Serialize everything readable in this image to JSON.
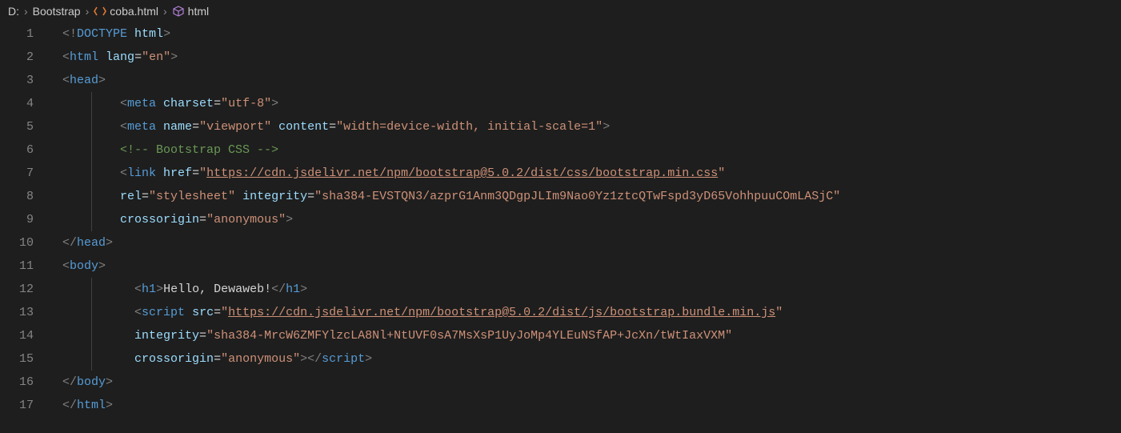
{
  "breadcrumb": {
    "drive": "D:",
    "folder": "Bootstrap",
    "file": "coba.html",
    "symbol": "html"
  },
  "gutter": [
    "1",
    "2",
    "3",
    "4",
    "5",
    "6",
    "7",
    "8",
    "9",
    "10",
    "11",
    "12",
    "13",
    "14",
    "15",
    "16",
    "17"
  ],
  "code": {
    "r1": {
      "a": "<!",
      "b": "DOCTYPE",
      "c": " html",
      "d": ">"
    },
    "r2": {
      "a": "<",
      "b": "html",
      "c": " lang",
      "d": "=",
      "e": "\"en\"",
      "f": ">"
    },
    "r3": {
      "a": "<",
      "b": "head",
      "c": ">"
    },
    "r4": {
      "a": "<",
      "b": "meta",
      "c": " charset",
      "d": "=",
      "e": "\"utf-8\"",
      "f": ">"
    },
    "r5": {
      "a": "<",
      "b": "meta",
      "c": " name",
      "d": "=",
      "e": "\"viewport\"",
      "f": " content",
      "g": "=",
      "h": "\"width=device-width, initial-scale=1\"",
      "i": ">"
    },
    "r6": {
      "a": "<!-- Bootstrap CSS -->"
    },
    "r7": {
      "a": "<",
      "b": "link",
      "c": " href",
      "d": "=",
      "e": "\"",
      "f": "https://cdn.jsdelivr.net/npm/bootstrap@5.0.2/dist/css/bootstrap.min.css",
      "g": "\""
    },
    "r8": {
      "a": "rel",
      "b": "=",
      "c": "\"stylesheet\"",
      "d": " integrity",
      "e": "=",
      "f": "\"sha384-EVSTQN3/azprG1Anm3QDgpJLIm9Nao0Yz1ztcQTwFspd3yD65VohhpuuCOmLASjC\""
    },
    "r9": {
      "a": "crossorigin",
      "b": "=",
      "c": "\"anonymous\"",
      "d": ">"
    },
    "r10": {
      "a": "</",
      "b": "head",
      "c": ">"
    },
    "r11": {
      "a": "<",
      "b": "body",
      "c": ">"
    },
    "r12": {
      "a": "<",
      "b": "h1",
      "c": ">",
      "d": "Hello, Dewaweb!",
      "e": "</",
      "f": "h1",
      "g": ">"
    },
    "r13": {
      "a": "<",
      "b": "script",
      "c": " src",
      "d": "=",
      "e": "\"",
      "f": "https://cdn.jsdelivr.net/npm/bootstrap@5.0.2/dist/js/bootstrap.bundle.min.js",
      "g": "\""
    },
    "r14": {
      "a": "integrity",
      "b": "=",
      "c": "\"sha384-MrcW6ZMFYlzcLA8Nl+NtUVF0sA7MsXsP1UyJoMp4YLEuNSfAP+JcXn/tWtIaxVXM\""
    },
    "r15": {
      "a": "crossorigin",
      "b": "=",
      "c": "\"anonymous\"",
      "d": "></",
      "e": "script",
      "f": ">"
    },
    "r16": {
      "a": "</",
      "b": "body",
      "c": ">"
    },
    "r17": {
      "a": "</",
      "b": "html",
      "c": ">"
    }
  }
}
